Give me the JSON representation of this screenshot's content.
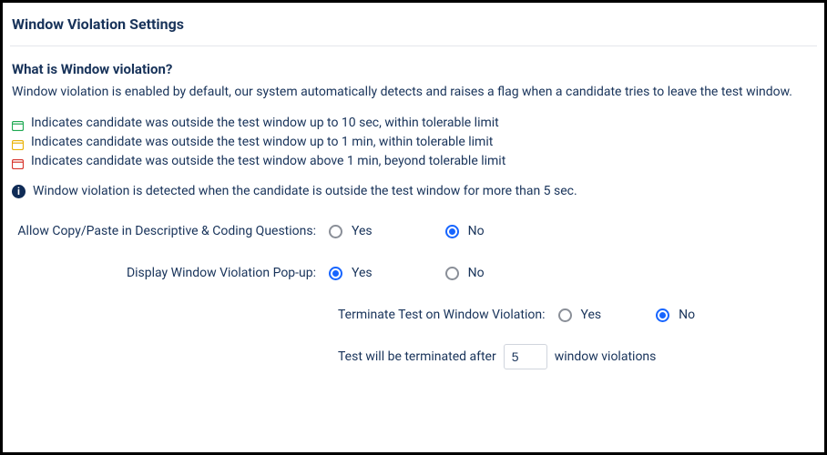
{
  "page_title": "Window Violation Settings",
  "section": {
    "heading": "What is Window violation?",
    "description": "Window violation is enabled by default, our system automatically detects and raises a flag when a candidate tries to leave the test window."
  },
  "legend": [
    {
      "icon": "browser-green-icon",
      "color": "#1ea952",
      "text": "Indicates candidate was outside the test window up to 10 sec, within tolerable limit"
    },
    {
      "icon": "browser-yellow-icon",
      "color": "#e9b208",
      "text": "Indicates candidate was outside the test window up to 1 min, within tolerable limit"
    },
    {
      "icon": "browser-red-icon",
      "color": "#d7352c",
      "text": "Indicates candidate was outside the test window above 1 min, beyond tolerable limit"
    }
  ],
  "info_note": "Window violation is detected when the candidate is outside the test window for more than 5 sec.",
  "form": {
    "allow_copy_paste": {
      "label": "Allow Copy/Paste in Descriptive & Coding Questions:",
      "yes": "Yes",
      "no": "No",
      "selected": "no"
    },
    "display_popup": {
      "label": "Display Window Violation Pop-up:",
      "yes": "Yes",
      "no": "No",
      "selected": "yes"
    },
    "terminate": {
      "label": "Terminate Test on Window Violation:",
      "yes": "Yes",
      "no": "No",
      "selected": "no"
    },
    "threshold": {
      "prefix": "Test will be terminated after",
      "value": "5",
      "suffix": "window violations"
    }
  }
}
